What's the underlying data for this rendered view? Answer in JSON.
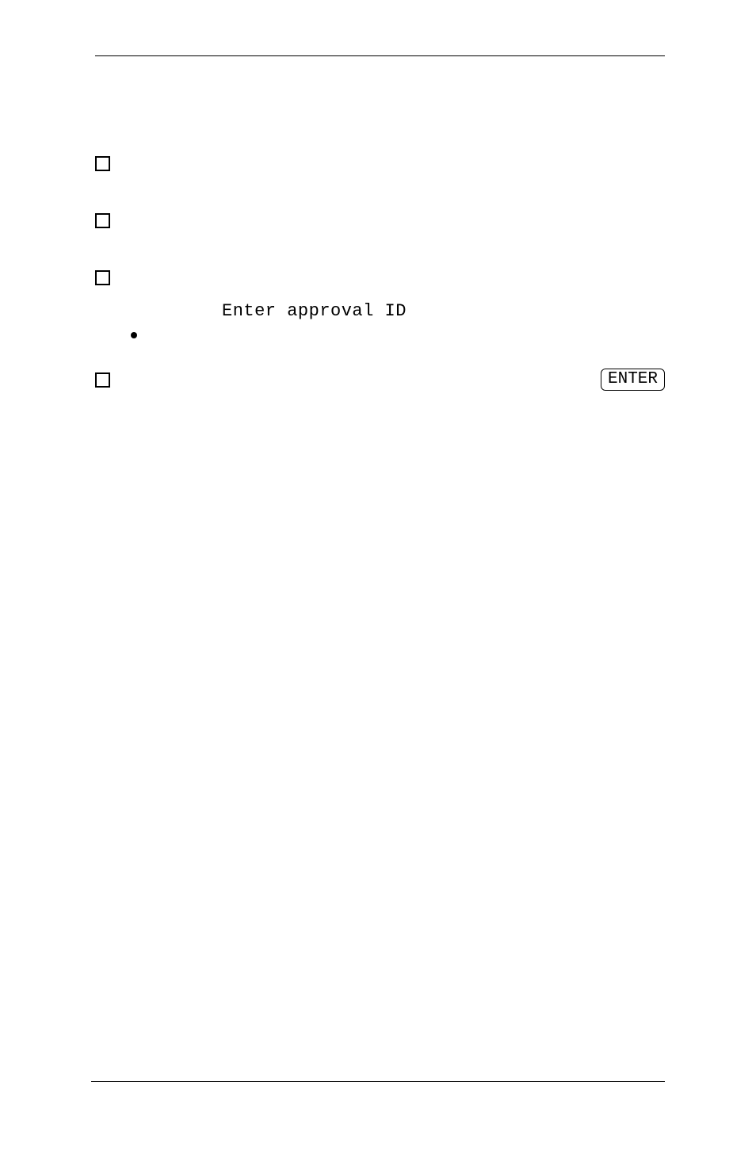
{
  "lines": {
    "monospace_prompt": "Enter approval ID"
  },
  "keys": {
    "enter": "ENTER"
  }
}
